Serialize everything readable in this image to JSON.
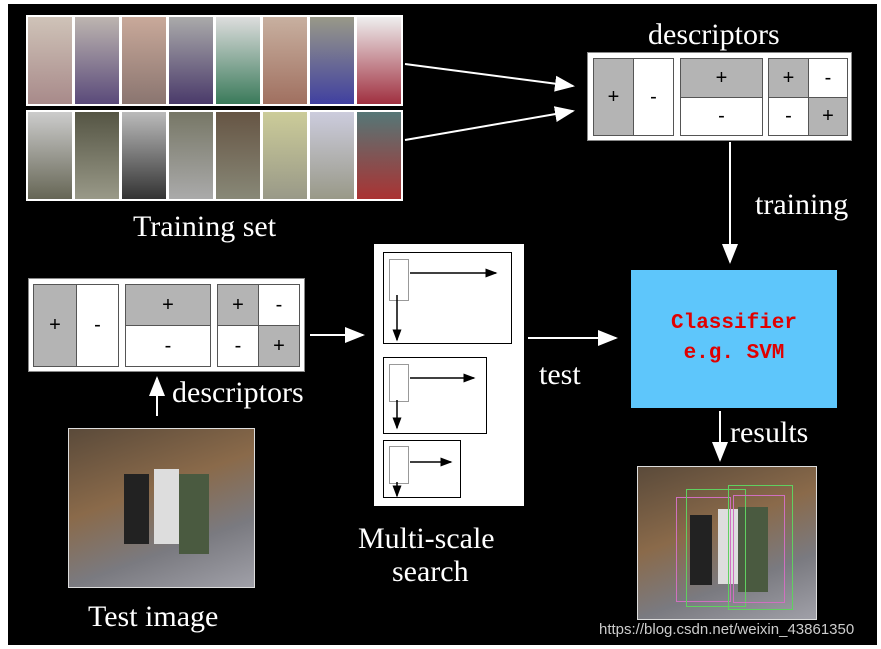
{
  "labels": {
    "descriptors_top": "descriptors",
    "training_set": "Training set",
    "training": "training",
    "descriptors_bottom": "descriptors",
    "test": "test",
    "multi_scale_1": "Multi-scale",
    "multi_scale_2": "search",
    "results": "results",
    "test_image": "Test image"
  },
  "classifier": {
    "line1": "Classifier",
    "line2": "e.g. SVM",
    "color": "#5ec6fb",
    "text_color": "#e00000"
  },
  "descriptor_signs": {
    "a_left": "+",
    "a_right": "-",
    "b_top": "+",
    "b_bottom": "-",
    "c_tl": "+",
    "c_tr": "-",
    "c_bl": "-",
    "c_br": "+"
  },
  "watermark": "https://blog.csdn.net/weixin_43861350"
}
